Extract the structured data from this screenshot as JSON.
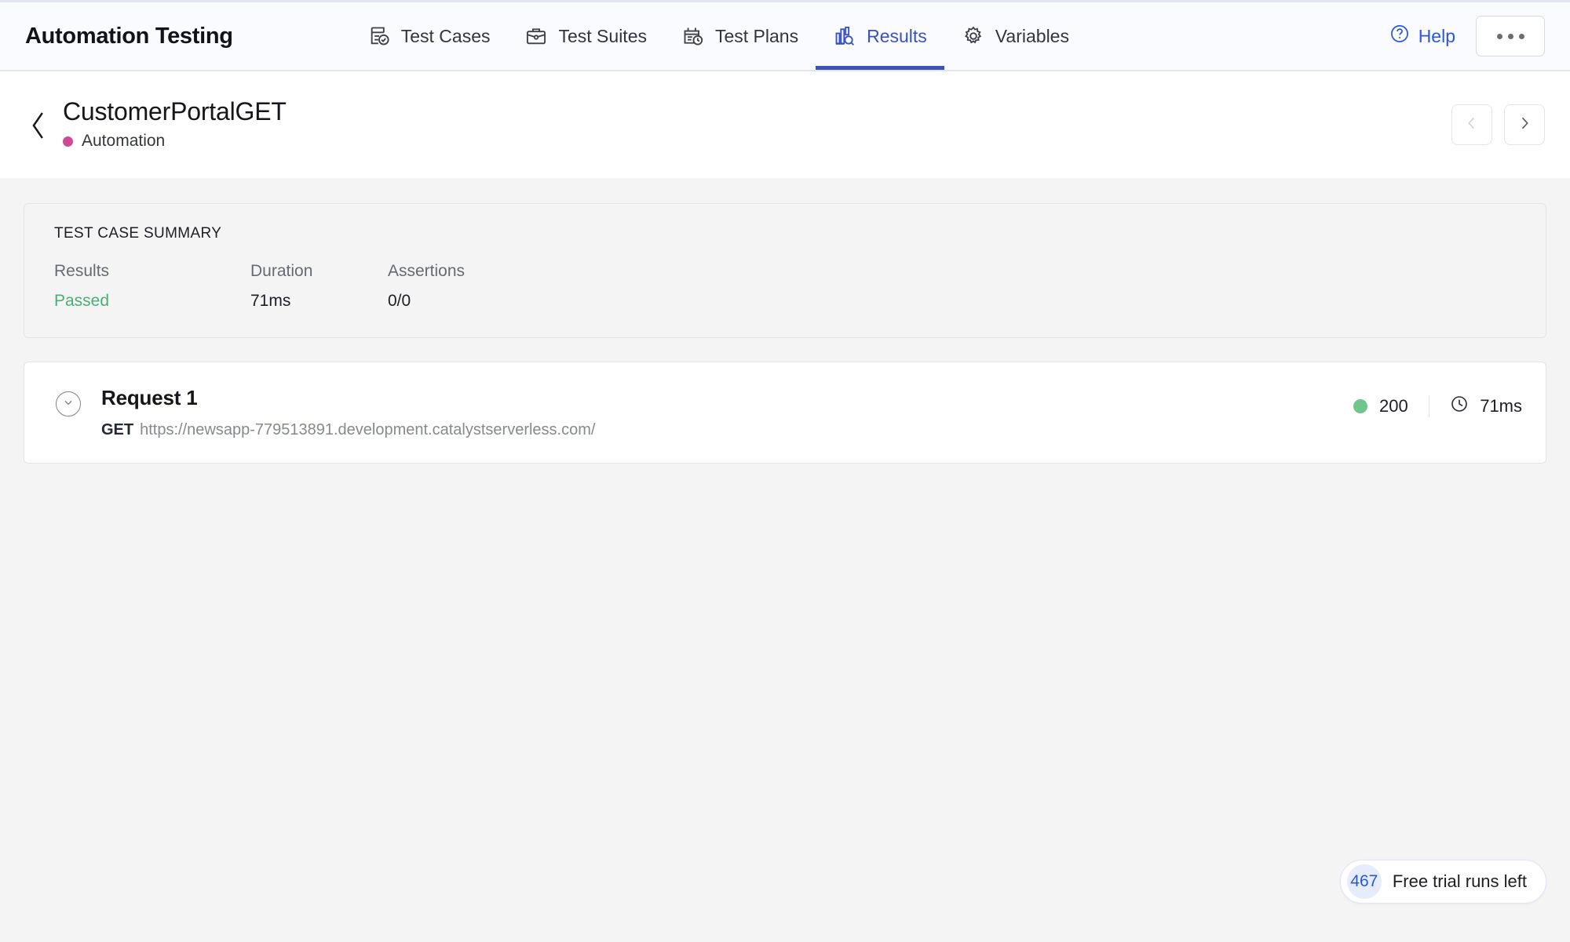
{
  "topnav": {
    "brand": "Automation Testing",
    "tabs": [
      {
        "label": "Test Cases",
        "icon": "document-check-icon",
        "active": false
      },
      {
        "label": "Test Suites",
        "icon": "briefcase-icon",
        "active": false
      },
      {
        "label": "Test Plans",
        "icon": "calendar-clock-icon",
        "active": false
      },
      {
        "label": "Results",
        "icon": "bar-chart-search-icon",
        "active": true
      },
      {
        "label": "Variables",
        "icon": "gear-icon",
        "active": false
      }
    ],
    "help_label": "Help",
    "help_icon": "question-circle-icon",
    "more_icon": "ellipsis-icon",
    "active_color": "#3a52bf",
    "help_color": "#2b58d8"
  },
  "pagehead": {
    "back_icon": "chevron-left-icon",
    "title": "CustomerPortalGET",
    "subtitle": "Automation",
    "subtitle_dot_color": "#cf4a95",
    "prev_icon": "chevron-left-icon",
    "next_icon": "chevron-right-icon"
  },
  "summary": {
    "heading": "TEST CASE SUMMARY",
    "fields": [
      {
        "label": "Results",
        "value": "Passed"
      },
      {
        "label": "Duration",
        "value": "71ms"
      },
      {
        "label": "Assertions",
        "value": "0/0"
      }
    ],
    "pass_color": "#4caf72"
  },
  "request": {
    "toggle_icon": "chevron-down-circle-icon",
    "title": "Request 1",
    "method": "GET",
    "url": "https://newsapp-779513891.development.catalystserverless.com/",
    "status_code": "200",
    "status_color": "#6ec68a",
    "status_dot_icon": "status-dot-icon",
    "duration": "71ms",
    "clock_icon": "clock-icon"
  },
  "trial": {
    "count": "467",
    "label": "Free trial runs left"
  }
}
